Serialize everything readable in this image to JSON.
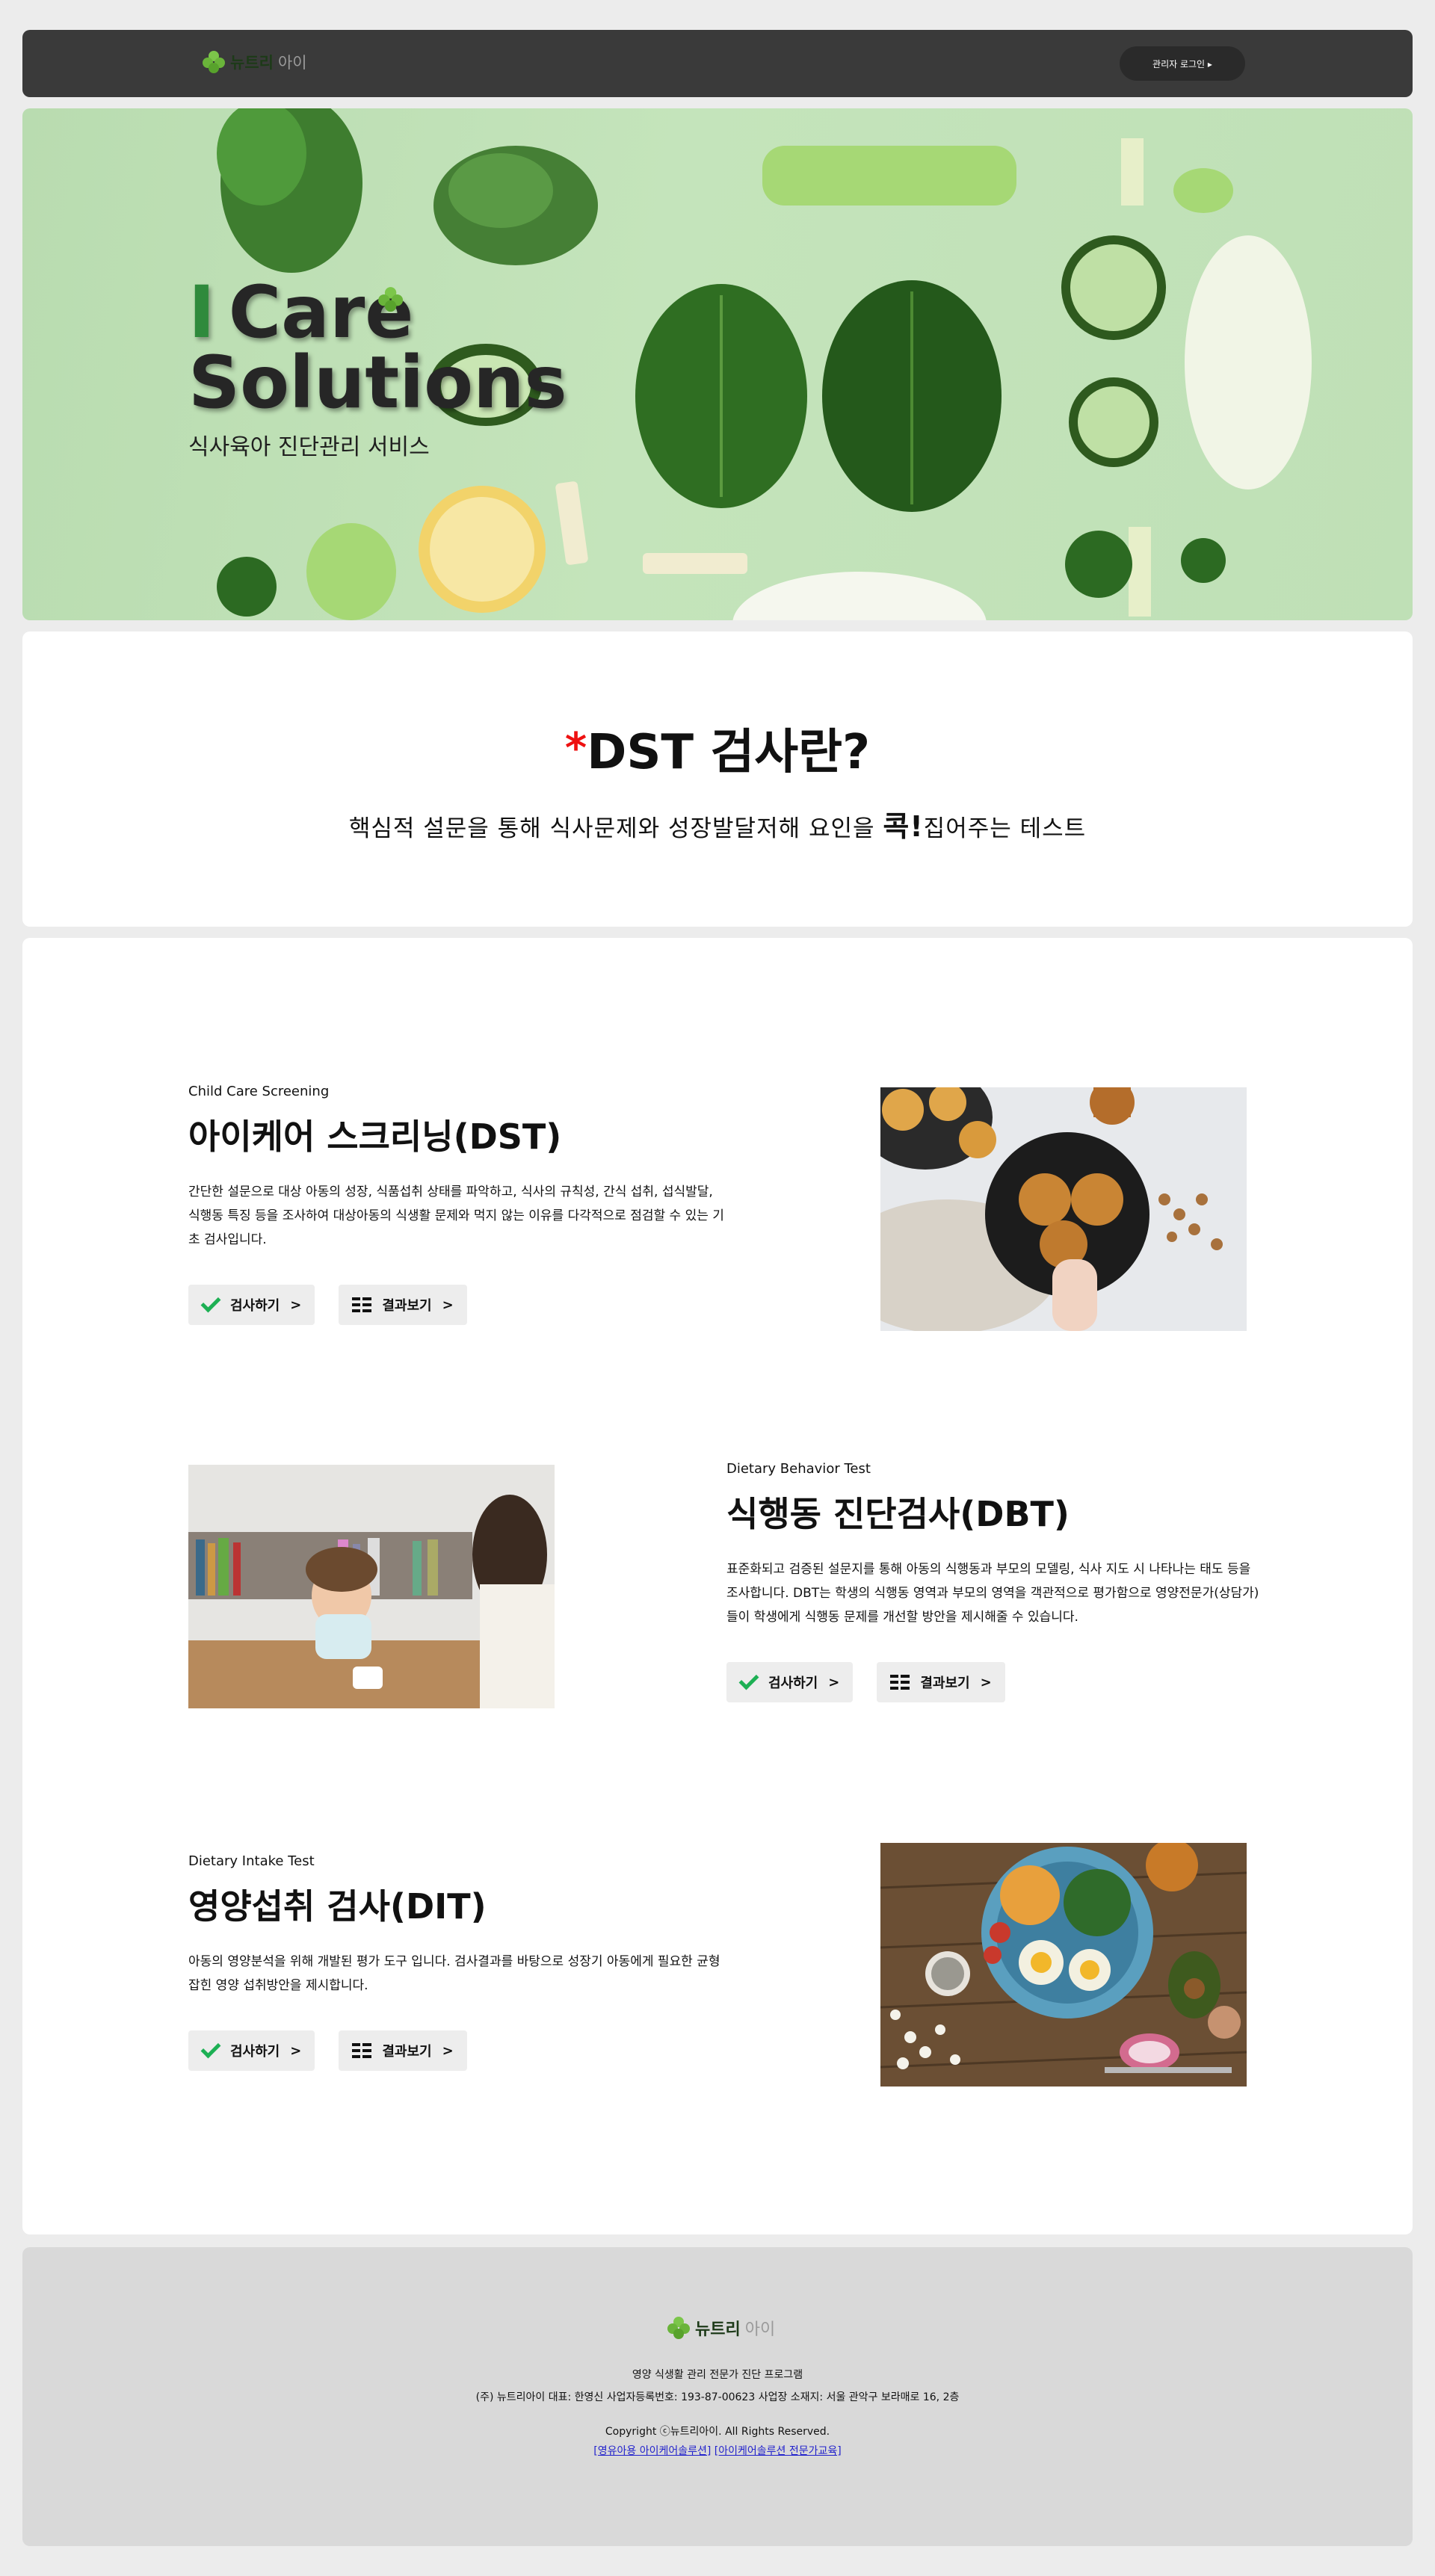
{
  "header": {
    "logo_main": "뉴트리",
    "logo_sub": "아이",
    "admin_button": "관리자 로그인 ▸"
  },
  "hero": {
    "title_i": "I",
    "title_line1": "Care",
    "title_line2": "Solutions",
    "subtitle": "식사육아 진단관리 서비스"
  },
  "intro": {
    "star": "*",
    "title": "DST 검사란?",
    "desc_before": "핵심적 설문을 통해 식사문제와 성장발달저해 요인을 ",
    "desc_bold": "콕!",
    "desc_after": "집어주는 테스트"
  },
  "tests": [
    {
      "eng": "Child Care Screening",
      "title": "아이케어 스크리닝(DST)",
      "desc": "간단한 설문으로 대상 아동의 성장, 식품섭취 상태를 파악하고, 식사의 규칙성, 간식 섭취, 섭식발달, 식행동 특징 등을 조사하여 대상아동의 식생활 문제와 먹지 않는 이유를 다각적으로 점검할 수 있는 기초 검사입니다.",
      "btn_test": "검사하기",
      "btn_result": "결과보기"
    },
    {
      "eng": "Dietary Behavior Test",
      "title": "식행동 진단검사(DBT)",
      "desc": "표준화되고 검증된 설문지를 통해 아동의 식행동과 부모의 모델링, 식사 지도 시 나타나는 태도 등을 조사합니다. DBT는 학생의 식행동 영역과 부모의 영역을 객관적으로 평가함으로 영양전문가(상담가)들이 학생에게 식행동 문제를 개선할 방안을 제시해줄 수 있습니다.",
      "btn_test": "검사하기",
      "btn_result": "결과보기"
    },
    {
      "eng": "Dietary Intake Test",
      "title": "영양섭취 검사(DIT)",
      "desc": "아동의 영양분석을 위해 개발된 평가 도구 입니다. 검사결과를 바탕으로 성장기 아동에게 필요한 균형잡힌 영양 섭취방안을 제시합니다.",
      "btn_test": "검사하기",
      "btn_result": "결과보기"
    }
  ],
  "footer": {
    "logo_main": "뉴트리",
    "logo_sub": "아이",
    "tagline": "영양 식생활 관리 전문가 진단 프로그램",
    "company": "(주) 뉴트리아이 대표: 한영신 사업자등록번호: 193-87-00623 사업장 소재지: 서울 관악구 보라매로 16, 2층",
    "copyright": "Copyright ⓒ뉴트리아이. All Rights Reserved.",
    "link1": "[영유아용 아이케어솔루션]",
    "link2": "[아이케어솔루션 전문가교육]"
  },
  "colors": {
    "accent_green": "#1db054",
    "header_bg": "#3a3a3a",
    "star_red": "#ee1111",
    "link_blue": "#2222cc"
  }
}
